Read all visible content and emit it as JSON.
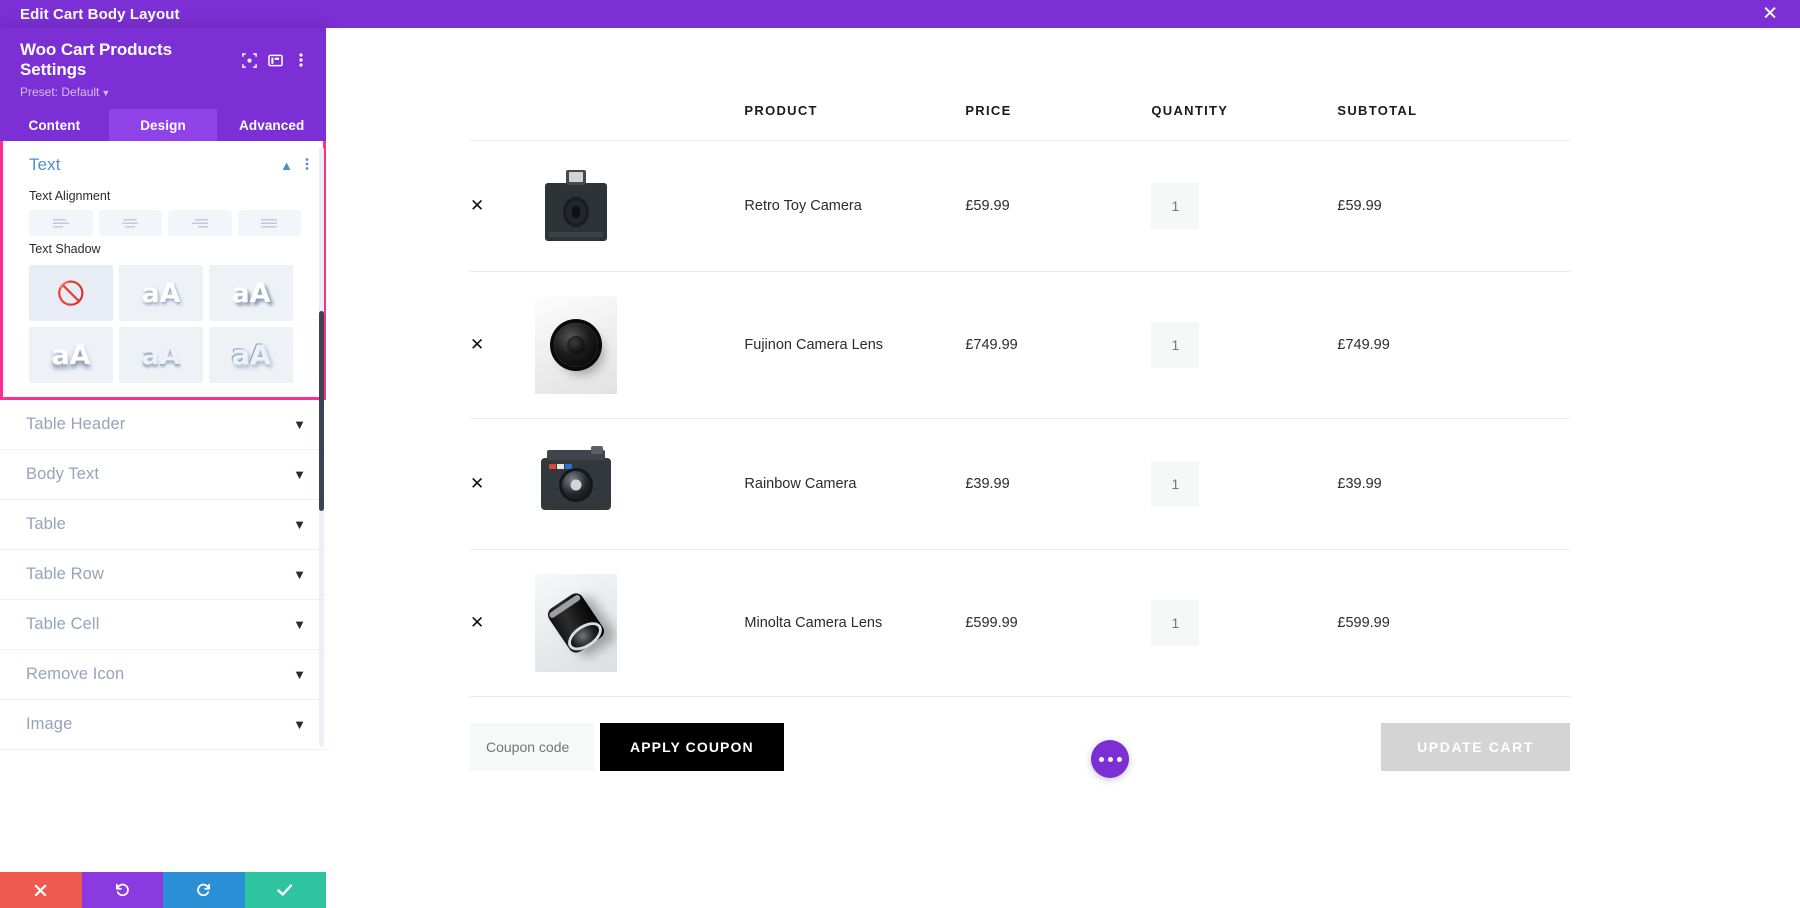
{
  "topbar": {
    "title": "Edit Cart Body Layout",
    "close_icon": "close-icon",
    "background": "#7b2fd4"
  },
  "settings_panel": {
    "title": "Woo Cart Products Settings",
    "preset_label": "Preset: Default",
    "header_icons": [
      "focus-target-icon",
      "panel-layout-icon",
      "more-vertical-icon"
    ],
    "tabs": [
      {
        "label": "Content",
        "active": false
      },
      {
        "label": "Design",
        "active": true
      },
      {
        "label": "Advanced",
        "active": false
      }
    ],
    "active_section": {
      "name": "Text",
      "highlight_color": "#ff2d8e",
      "collapse_icon": "chevron-up-icon",
      "options_icon": "more-vertical-icon",
      "fields": [
        {
          "label": "Text Alignment",
          "type": "icon-group",
          "options": [
            "align-left-icon",
            "align-center-icon",
            "align-right-icon",
            "align-justify-icon"
          ],
          "selected": -1
        },
        {
          "label": "Text Shadow",
          "type": "preset-grid",
          "options": [
            {
              "name": "no-shadow",
              "glyph": "⃠",
              "selected": true
            },
            {
              "name": "shadow-soft",
              "glyph": "aA",
              "selected": false
            },
            {
              "name": "shadow-offset",
              "glyph": "aA",
              "selected": false
            },
            {
              "name": "shadow-bottom",
              "glyph": "aA",
              "selected": false
            },
            {
              "name": "shadow-emboss",
              "glyph": "aA",
              "selected": false
            },
            {
              "name": "shadow-outline",
              "glyph": "aA",
              "selected": false
            }
          ]
        }
      ]
    },
    "collapsed_sections": [
      {
        "label": "Table Header",
        "icon": "chevron-down-icon"
      },
      {
        "label": "Body Text",
        "icon": "chevron-down-icon"
      },
      {
        "label": "Table",
        "icon": "chevron-down-icon"
      },
      {
        "label": "Table Row",
        "icon": "chevron-down-icon"
      },
      {
        "label": "Table Cell",
        "icon": "chevron-down-icon"
      },
      {
        "label": "Remove Icon",
        "icon": "chevron-down-icon"
      },
      {
        "label": "Image",
        "icon": "chevron-down-icon"
      }
    ],
    "footer_buttons": [
      {
        "name": "cancel",
        "icon": "close-icon",
        "color": "#ef5a50"
      },
      {
        "name": "undo",
        "icon": "undo-icon",
        "color": "#8a3ae0"
      },
      {
        "name": "redo",
        "icon": "redo-icon",
        "color": "#2a8fd4"
      },
      {
        "name": "save",
        "icon": "check-icon",
        "color": "#2ec4a0"
      }
    ]
  },
  "cart": {
    "columns": [
      "",
      "",
      "PRODUCT",
      "PRICE",
      "QUANTITY",
      "SUBTOTAL"
    ],
    "rows": [
      {
        "remove": "✕",
        "thumb": "retro-toy-camera-thumb",
        "name": "Retro Toy Camera",
        "price": "£59.99",
        "quantity": "1",
        "subtotal": "£59.99"
      },
      {
        "remove": "✕",
        "thumb": "fujinon-camera-lens-thumb",
        "name": "Fujinon Camera Lens",
        "price": "£749.99",
        "quantity": "1",
        "subtotal": "£749.99"
      },
      {
        "remove": "✕",
        "thumb": "rainbow-camera-thumb",
        "name": "Rainbow Camera",
        "price": "£39.99",
        "quantity": "1",
        "subtotal": "£39.99"
      },
      {
        "remove": "✕",
        "thumb": "minolta-camera-lens-thumb",
        "name": "Minolta Camera Lens",
        "price": "£599.99",
        "quantity": "1",
        "subtotal": "£599.99"
      }
    ],
    "coupon": {
      "placeholder": "Coupon code",
      "value": "",
      "apply_label": "APPLY COUPON"
    },
    "update_label": "UPDATE CART",
    "fab_icon": "more-horizontal-icon",
    "accent_color": "#7b2fd4"
  }
}
